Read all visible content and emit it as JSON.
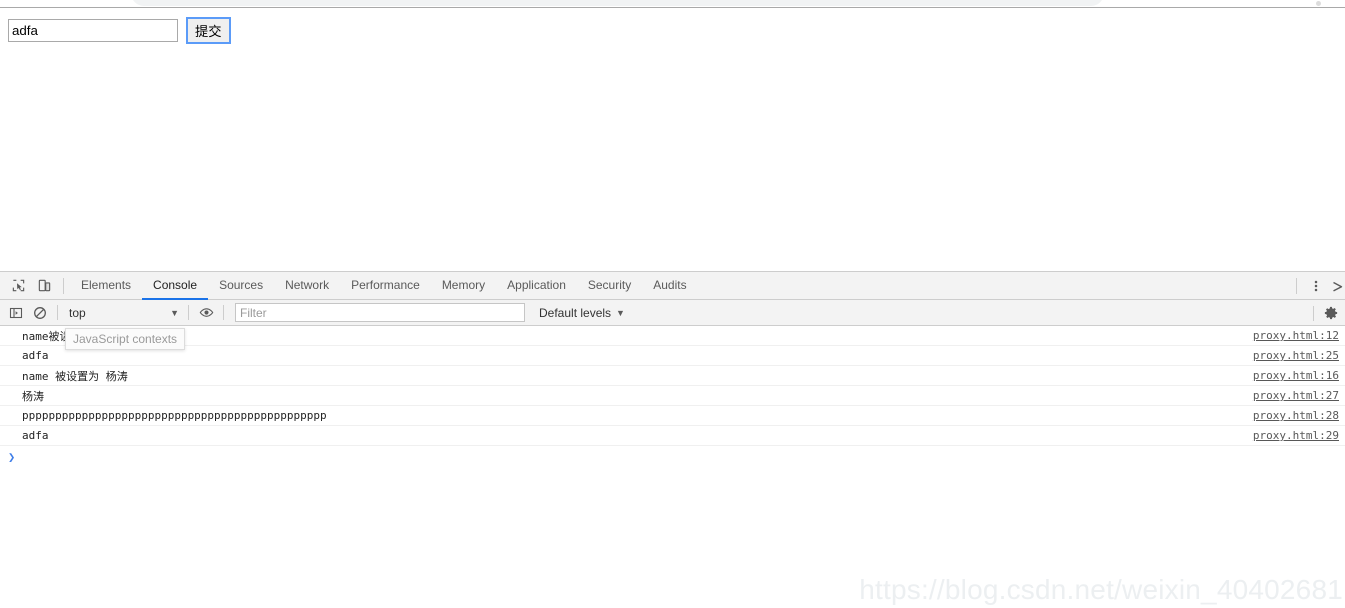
{
  "browser": {
    "omnibox_visible": true
  },
  "page": {
    "input": {
      "value": "adfa",
      "placeholder": ""
    },
    "submit_label": "提交"
  },
  "devtools": {
    "toolbar": {
      "inspect_icon": "inspect-element-icon",
      "device_icon": "device-toolbar-icon",
      "tabs": [
        {
          "label": "Elements",
          "active": false
        },
        {
          "label": "Console",
          "active": true
        },
        {
          "label": "Sources",
          "active": false
        },
        {
          "label": "Network",
          "active": false
        },
        {
          "label": "Performance",
          "active": false
        },
        {
          "label": "Memory",
          "active": false
        },
        {
          "label": "Application",
          "active": false
        },
        {
          "label": "Security",
          "active": false
        },
        {
          "label": "Audits",
          "active": false
        }
      ],
      "more_icon": "vertical-dots-icon",
      "close_icon": "close-icon"
    },
    "filterbar": {
      "sidebar_icon": "console-sidebar-icon",
      "clear_icon": "clear-console-icon",
      "context": "top",
      "context_caret": "▼",
      "eye_icon": "live-expression-eye-icon",
      "filter_placeholder": "Filter",
      "filter_value": "",
      "levels_label": "Default levels",
      "levels_caret": "▼",
      "settings_icon": "gear-icon"
    },
    "tooltip": "JavaScript contexts",
    "messages": [
      {
        "text": "name被读取",
        "source": "proxy.html:12"
      },
      {
        "text": "adfa",
        "source": "proxy.html:25"
      },
      {
        "text": "name 被设置为 杨涛",
        "source": "proxy.html:16"
      },
      {
        "text": "杨涛",
        "source": "proxy.html:27"
      },
      {
        "text": "pppppppppppppppppppppppppppppppppppppppppppppp",
        "source": "proxy.html:28"
      },
      {
        "text": "adfa",
        "source": "proxy.html:29"
      }
    ],
    "prompt": {
      "arrow": "❯",
      "value": ""
    }
  },
  "watermark": "https://blog.csdn.net/weixin_40402681",
  "colors": {
    "accent": "#1a73e8",
    "prompt": "#3f7ee8",
    "toolbar_bg": "#f3f3f3",
    "border": "#cdcdcd"
  }
}
